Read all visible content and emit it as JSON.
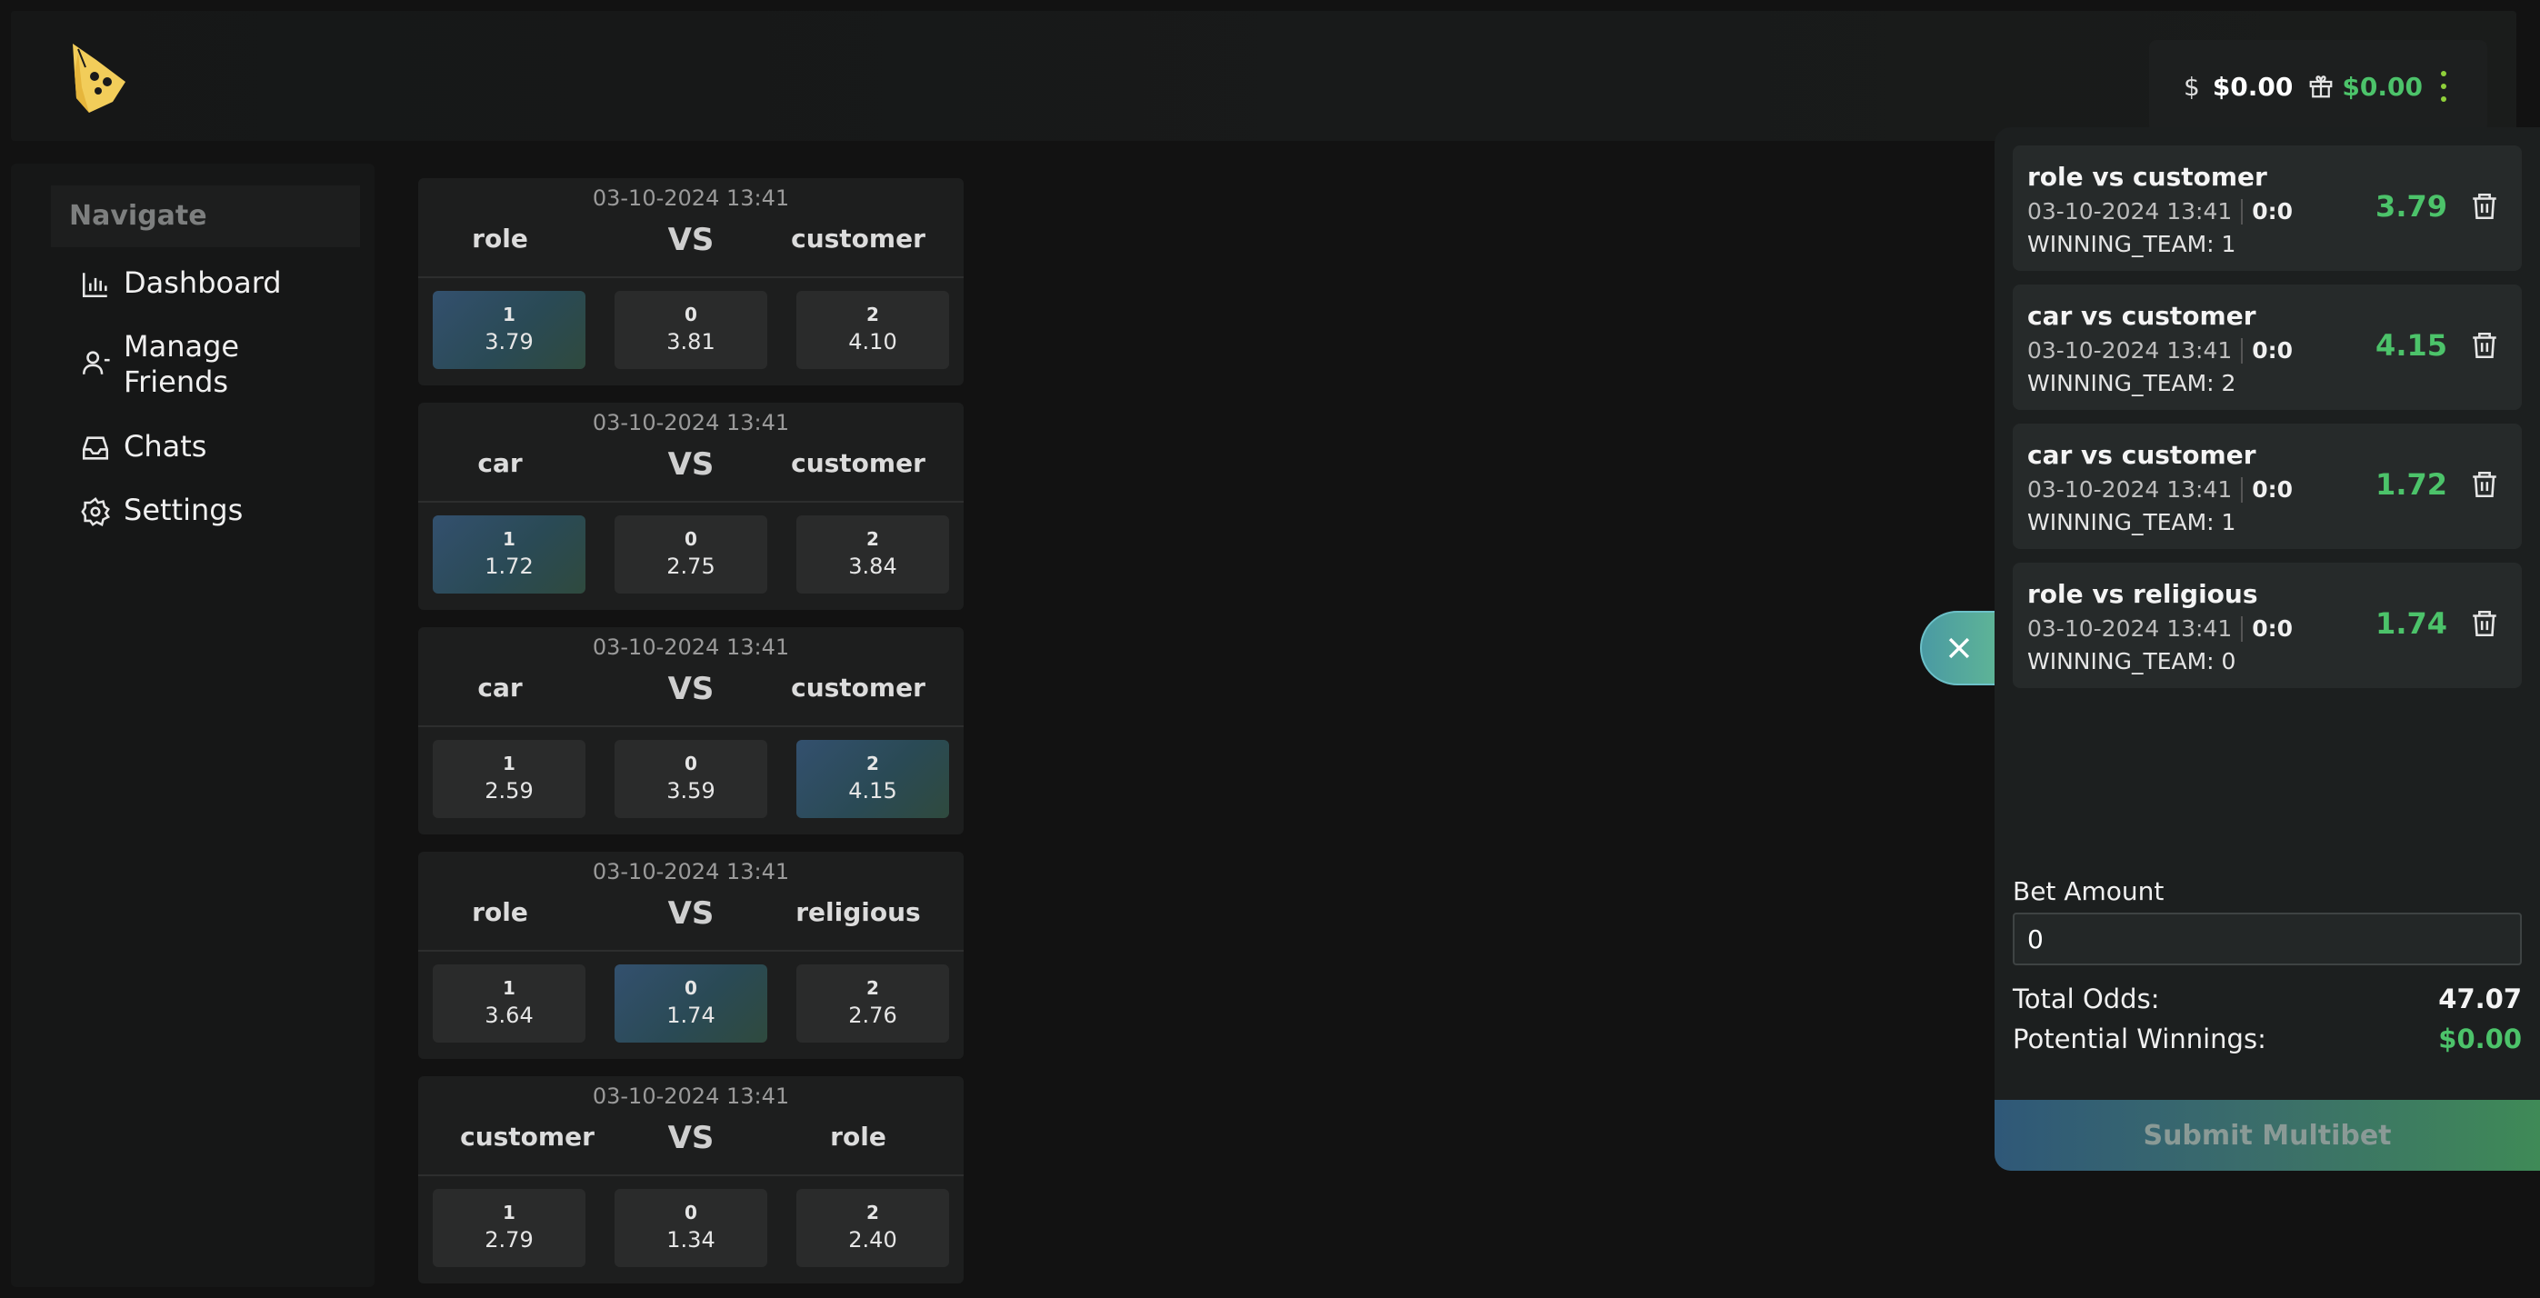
{
  "header": {
    "wallet": {
      "balance": "$0.00",
      "bonus": "$0.00"
    }
  },
  "sidebar": {
    "title": "Navigate",
    "items": [
      {
        "label": "Dashboard",
        "icon": "chart-icon"
      },
      {
        "label": "Manage Friends",
        "icon": "user-icon"
      },
      {
        "label": "Chats",
        "icon": "inbox-icon"
      },
      {
        "label": "Settings",
        "icon": "gear-icon"
      }
    ]
  },
  "matches": [
    {
      "date": "03-10-2024 13:41",
      "team1": "role",
      "vs": "VS",
      "team2": "customer",
      "odds": [
        {
          "label": "1",
          "value": "3.79",
          "selected": true
        },
        {
          "label": "0",
          "value": "3.81"
        },
        {
          "label": "2",
          "value": "4.10"
        }
      ]
    },
    {
      "date": "03-10-2024 13:41",
      "team1": "car",
      "vs": "VS",
      "team2": "customer",
      "odds": [
        {
          "label": "1",
          "value": "1.72",
          "selected": true
        },
        {
          "label": "0",
          "value": "2.75"
        },
        {
          "label": "2",
          "value": "3.84"
        }
      ]
    },
    {
      "date": "03-10-2024 13:41",
      "team1": "car",
      "vs": "VS",
      "team2": "customer",
      "odds": [
        {
          "label": "1",
          "value": "2.59"
        },
        {
          "label": "0",
          "value": "3.59"
        },
        {
          "label": "2",
          "value": "4.15",
          "selected": true
        }
      ]
    },
    {
      "date": "03-10-2024 13:41",
      "team1": "role",
      "vs": "VS",
      "team2": "religious",
      "odds": [
        {
          "label": "1",
          "value": "3.64"
        },
        {
          "label": "0",
          "value": "1.74",
          "selected": true
        },
        {
          "label": "2",
          "value": "2.76"
        }
      ]
    },
    {
      "date": "03-10-2024 13:41",
      "team1": "customer",
      "vs": "VS",
      "team2": "role",
      "odds": [
        {
          "label": "1",
          "value": "2.79"
        },
        {
          "label": "0",
          "value": "1.34"
        },
        {
          "label": "2",
          "value": "2.40"
        }
      ]
    }
  ],
  "betslip": {
    "bets": [
      {
        "title": "role vs customer",
        "date": "03-10-2024 13:41",
        "score": "0:0",
        "winning": "WINNING_TEAM: 1",
        "odds": "3.79"
      },
      {
        "title": "car vs customer",
        "date": "03-10-2024 13:41",
        "score": "0:0",
        "winning": "WINNING_TEAM: 2",
        "odds": "4.15"
      },
      {
        "title": "car vs customer",
        "date": "03-10-2024 13:41",
        "score": "0:0",
        "winning": "WINNING_TEAM: 1",
        "odds": "1.72"
      },
      {
        "title": "role vs religious",
        "date": "03-10-2024 13:41",
        "score": "0:0",
        "winning": "WINNING_TEAM: 0",
        "odds": "1.74"
      }
    ],
    "bet_amount_label": "Bet Amount",
    "bet_amount_value": "0",
    "total_odds_label": "Total Odds:",
    "total_odds_value": "47.07",
    "potential_label": "Potential Winnings:",
    "potential_value": "$0.00",
    "submit_label": "Submit Multibet"
  },
  "colors": {
    "accent_green": "#4cc36a",
    "selected_odd": "#33506e",
    "background": "#121212"
  }
}
